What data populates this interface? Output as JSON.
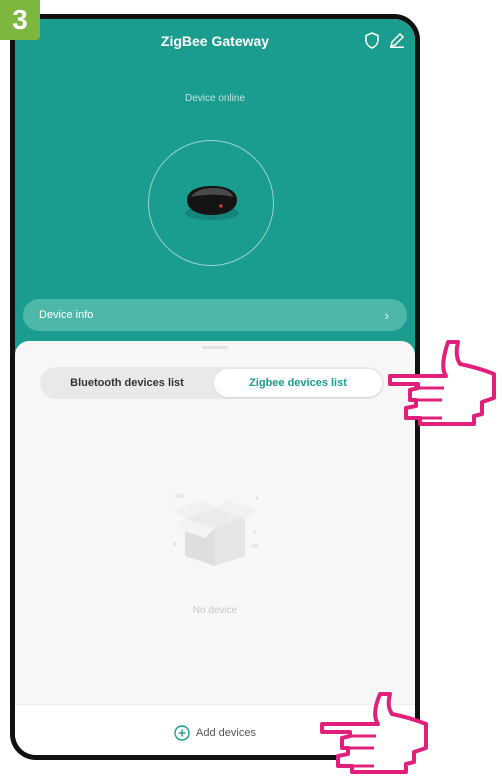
{
  "step": "3",
  "header": {
    "title": "ZigBee Gateway",
    "status": "Device online",
    "device_info": "Device info"
  },
  "tabs": {
    "bluetooth": "Bluetooth devices list",
    "zigbee": "Zigbee devices list",
    "active": "zigbee"
  },
  "empty_state": {
    "text": "No device"
  },
  "footer": {
    "add_label": "Add devices"
  },
  "colors": {
    "teal": "#1a9d8e",
    "step_badge": "#7db73f",
    "pointer_hand": "#e0207a"
  },
  "icons": [
    "shield-icon",
    "edit-icon",
    "chevron-right-icon",
    "add-circle-icon",
    "empty-box-icon",
    "pointing-hand-icon"
  ]
}
